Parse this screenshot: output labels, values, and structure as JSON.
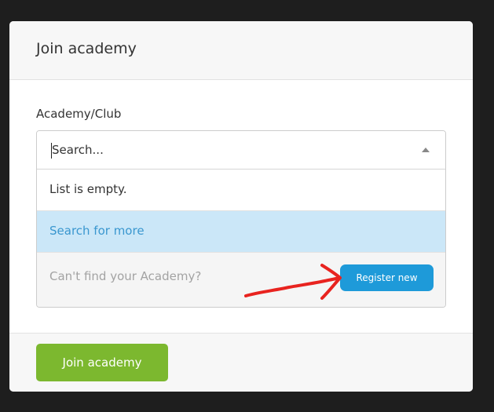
{
  "modal": {
    "title": "Join academy"
  },
  "form": {
    "field_label": "Academy/Club",
    "search": {
      "placeholder": "Search...",
      "value": ""
    },
    "dropdown": {
      "empty_message": "List is empty.",
      "search_more_label": "Search for more",
      "register_hint": "Can't find your Academy?",
      "register_button_label": "Register new"
    }
  },
  "footer": {
    "join_button_label": "Join academy"
  },
  "annotation": {
    "arrow_color": "#e8231f",
    "icon": "hand-drawn-arrow-icon"
  },
  "colors": {
    "accent_blue": "#1e9ad9",
    "highlight_row": "#cbe7f8",
    "join_green": "#7cb82f",
    "background": "#1e1e1e"
  }
}
